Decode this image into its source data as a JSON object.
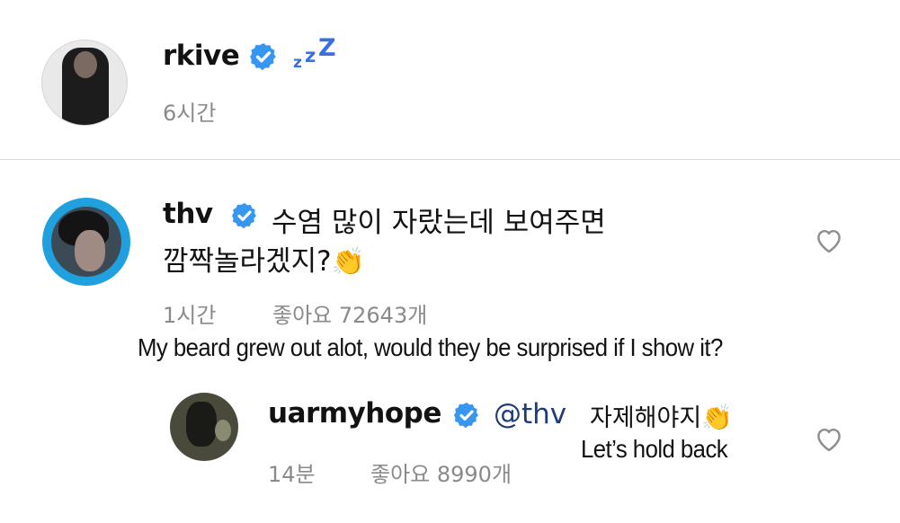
{
  "post": {
    "username": "rkive",
    "status_emoji": "zzZ",
    "time": "6시간"
  },
  "comments": [
    {
      "username": "thv",
      "text_line1": "수염 많이 자랐는데 보여주면",
      "text_line2": "깜짝놀라겠지?",
      "emoji": "👏",
      "time": "1시간",
      "likes": "좋아요 72643개",
      "translation": "My beard grew out alot, would they be surprised if I show it?"
    },
    {
      "username": "uarmyhope",
      "mention": "@thv",
      "text": "자제해야지",
      "emoji": "👏",
      "time": "14분",
      "likes": "좋아요 8990개",
      "translation": "Let’s hold back"
    }
  ],
  "icons": {
    "verified_badge": "verified-badge-icon",
    "heart": "heart-outline-icon"
  },
  "colors": {
    "verified_blue": "#3797f0",
    "meta_gray": "#8a8a8a",
    "mention_navy": "#1f3b7a"
  }
}
